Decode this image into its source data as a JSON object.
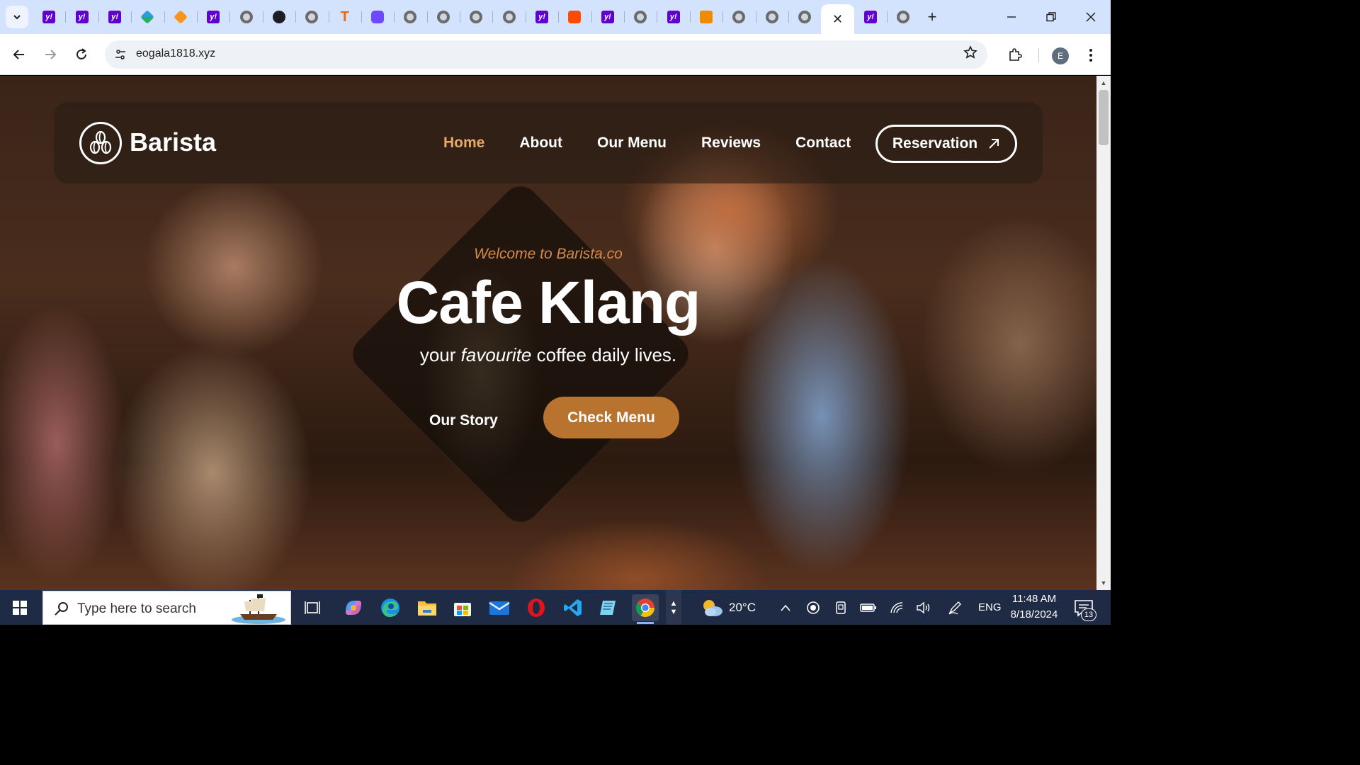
{
  "browser": {
    "tabs": [
      {
        "icon": "yahoo-icon",
        "glyph": "y!"
      },
      {
        "icon": "yahoo-icon",
        "glyph": "y!"
      },
      {
        "icon": "yahoo-icon",
        "glyph": "y!"
      },
      {
        "icon": "grid-app-icon",
        "glyph": ""
      },
      {
        "icon": "cube-app-icon",
        "glyph": ""
      },
      {
        "icon": "yahoo-icon",
        "glyph": "y!"
      },
      {
        "icon": "globe-icon",
        "glyph": ""
      },
      {
        "icon": "github-icon",
        "glyph": ""
      },
      {
        "icon": "globe-icon",
        "glyph": ""
      },
      {
        "icon": "t-letter-icon",
        "glyph": "T"
      },
      {
        "icon": "proton-icon",
        "glyph": ""
      },
      {
        "icon": "globe-icon",
        "glyph": ""
      },
      {
        "icon": "globe-icon",
        "glyph": ""
      },
      {
        "icon": "globe-icon",
        "glyph": ""
      },
      {
        "icon": "globe-icon",
        "glyph": ""
      },
      {
        "icon": "yahoo-icon",
        "glyph": "y!"
      },
      {
        "icon": "zap-icon",
        "glyph": ""
      },
      {
        "icon": "yahoo-icon",
        "glyph": "y!"
      },
      {
        "icon": "globe-icon",
        "glyph": ""
      },
      {
        "icon": "yahoo-icon",
        "glyph": "y!"
      },
      {
        "icon": "orange-app-icon",
        "glyph": ""
      },
      {
        "icon": "globe-icon",
        "glyph": ""
      },
      {
        "icon": "globe-icon",
        "glyph": ""
      },
      {
        "icon": "globe-icon",
        "glyph": ""
      },
      {
        "icon": "close-icon",
        "glyph": "✕",
        "active": true
      },
      {
        "icon": "yahoo-icon",
        "glyph": "y!"
      },
      {
        "icon": "globe-icon",
        "glyph": ""
      }
    ],
    "new_tab": "+",
    "url": "eogala1818.xyz",
    "profile_initial": "E"
  },
  "site": {
    "brand": "Barista",
    "nav": [
      {
        "label": "Home",
        "active": true
      },
      {
        "label": "About",
        "active": false
      },
      {
        "label": "Our Menu",
        "active": false
      },
      {
        "label": "Reviews",
        "active": false
      },
      {
        "label": "Contact",
        "active": false
      }
    ],
    "reservation_label": "Reservation",
    "hero": {
      "eyebrow": "Welcome to Barista.co",
      "title": "Cafe Klang",
      "subtitle_pre": "your ",
      "subtitle_em": "favourite",
      "subtitle_post": " coffee daily lives.",
      "our_story_label": "Our Story",
      "check_menu_label": "Check Menu"
    },
    "colors": {
      "accent": "#b8732f",
      "nav_active": "#e8a868"
    }
  },
  "taskbar": {
    "search_placeholder": "Type here to search",
    "weather": "20°C",
    "language": "ENG",
    "time": "11:48 AM",
    "date": "8/18/2024",
    "notifications": "13"
  }
}
